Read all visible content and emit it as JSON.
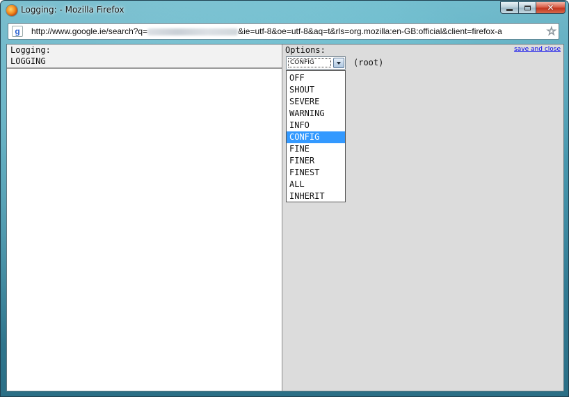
{
  "window": {
    "title": "Logging: - Mozilla Firefox",
    "close_glyph": "✕"
  },
  "address": {
    "url_prefix": "http://www.google.ie/search?q=",
    "url_suffix": "&ie=utf-8&oe=utf-8&aq=t&rls=org.mozilla:en-GB:official&client=firefox-a",
    "site_icon_letter": "g",
    "bookmark_star": "☆"
  },
  "left": {
    "label": "Logging:",
    "logger_name": "LOGGING"
  },
  "right": {
    "options_label": "Options:",
    "save_link": "save and close",
    "select_value": "CONFIG",
    "root_label": "(root)",
    "options": [
      "OFF",
      "SHOUT",
      "SEVERE",
      "WARNING",
      "INFO",
      "CONFIG",
      "FINE",
      "FINER",
      "FINEST",
      "ALL",
      "INHERIT"
    ],
    "selected_option": "CONFIG"
  },
  "colors": {
    "selection": "#3399ff",
    "link": "#0000ee",
    "right_pane_bg": "#dcdcdc"
  }
}
